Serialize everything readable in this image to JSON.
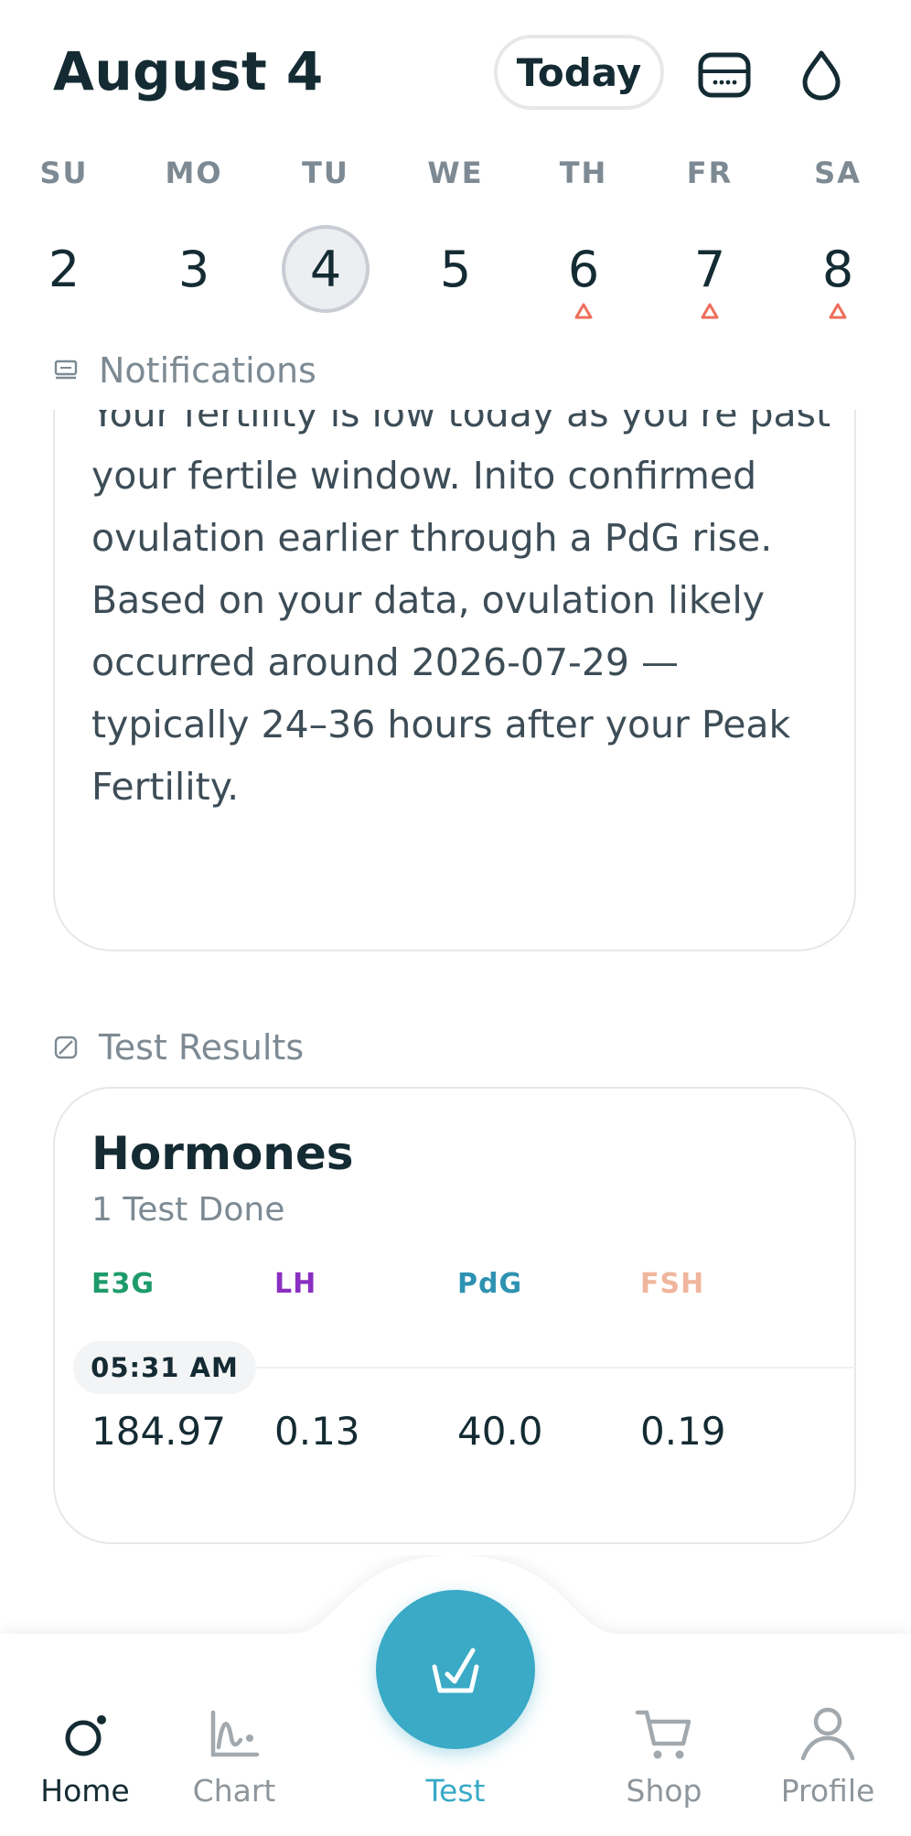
{
  "header": {
    "date_title": "August 4",
    "today_label": "Today",
    "reader_icon": "reader-device-icon",
    "drop_icon": "drop-icon"
  },
  "week": {
    "days": [
      {
        "dow": "SU",
        "num": "2",
        "selected": false,
        "marker": false
      },
      {
        "dow": "MO",
        "num": "3",
        "selected": false,
        "marker": false
      },
      {
        "dow": "TU",
        "num": "4",
        "selected": true,
        "marker": false
      },
      {
        "dow": "WE",
        "num": "5",
        "selected": false,
        "marker": false
      },
      {
        "dow": "TH",
        "num": "6",
        "selected": false,
        "marker": true
      },
      {
        "dow": "FR",
        "num": "7",
        "selected": false,
        "marker": true
      },
      {
        "dow": "SA",
        "num": "8",
        "selected": false,
        "marker": true
      }
    ],
    "marker_color": "#ef6e5a"
  },
  "notifications": {
    "label": "Notifications",
    "message": "Your fertility is low today as you're past your fertile window. Inito confirmed ovulation earlier through a PdG rise. Based on your data, ovulation likely occurred around 2026-07-29 — typically 24–36 hours after your Peak Fertility."
  },
  "test_results": {
    "label": "Test Results",
    "card_title": "Hormones",
    "tests_done": "1 Test Done",
    "hormones": [
      {
        "name": "E3G",
        "value": "184.97",
        "color": "#1e9b6a"
      },
      {
        "name": "LH",
        "value": "0.13",
        "color": "#8a2fc1"
      },
      {
        "name": "PdG",
        "value": "40.0",
        "color": "#2e92b2"
      },
      {
        "name": "FSH",
        "value": "0.19",
        "color": "#f0b69d"
      }
    ],
    "time": "05:31 AM"
  },
  "nav": {
    "home": "Home",
    "chart": "Chart",
    "test": "Test",
    "shop": "Shop",
    "profile": "Profile",
    "accent": "#3aaac6"
  }
}
